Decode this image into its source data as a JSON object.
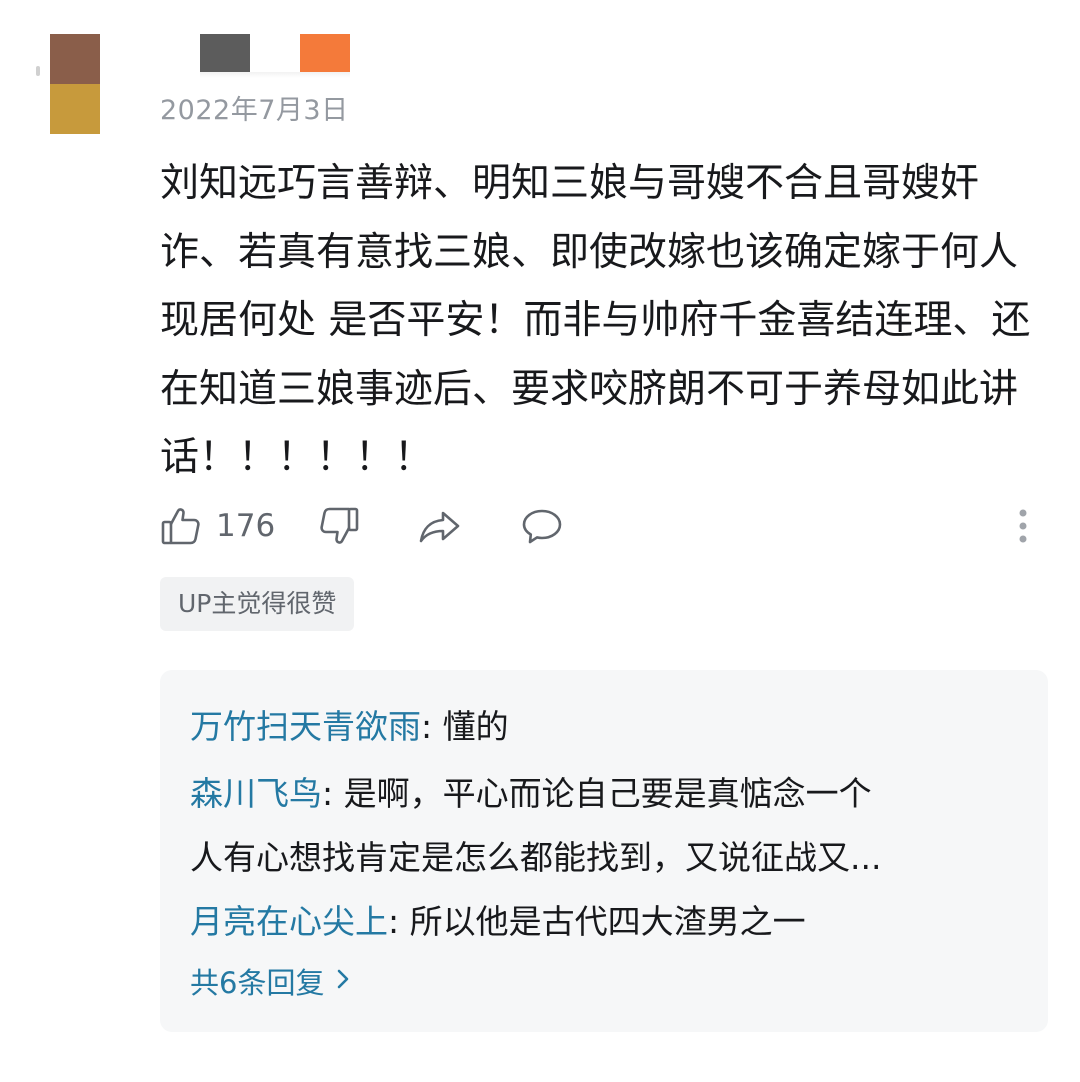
{
  "comment": {
    "date": "2022年7月3日",
    "text": "刘知远巧言善辩、明知三娘与哥嫂不合且哥嫂奸诈、若真有意找三娘、即使改嫁也该确定嫁于何人 现居何处 是否平安！而非与帅府千金喜结连理、还在知道三娘事迹后、要求咬脐朗不可于养母如此讲话！！！！！！",
    "like_count": "176",
    "up_badge": "UP主觉得很赞"
  },
  "replies": [
    {
      "name": "万竹扫天青欲雨",
      "text": ": 懂的"
    },
    {
      "name": "森川飞鸟",
      "text": ": 是啊，平心而论自己要是真惦念一个",
      "continuation": "人有心想找肯定是怎么都能找到，又说征战又..."
    },
    {
      "name": "月亮在心尖上",
      "text": ": 所以他是古代四大渣男之一"
    }
  ],
  "more_replies_label": "共6条回复",
  "colors": {
    "link": "#2479a3",
    "muted": "#9499a0",
    "reply_bg": "#f6f7f8"
  },
  "icons": [
    "thumbs-up-icon",
    "thumbs-down-icon",
    "share-icon",
    "reply-icon",
    "more-vertical-icon",
    "chevron-right-icon"
  ]
}
